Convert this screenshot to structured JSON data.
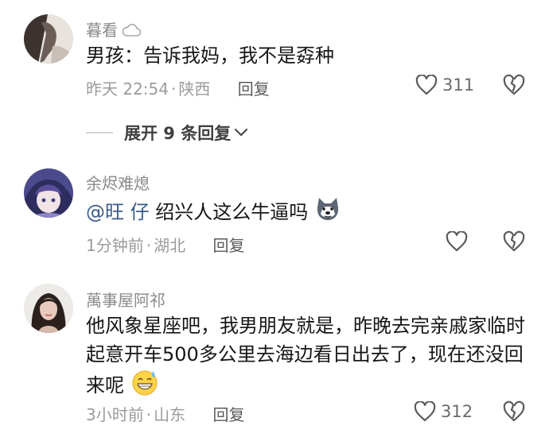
{
  "comments": [
    {
      "username": "暮看",
      "badge_icon": "cloud-icon",
      "text": "男孩：告诉我妈，我不是孬种",
      "time": "昨天 22:54",
      "location": "陕西",
      "reply_label": "回复",
      "likes": "311"
    },
    {
      "username": "余烬难熄",
      "mention": "@旺 仔",
      "text": " 绍兴人这么牛逼吗",
      "emoji_icon": "husky-dog-emoji",
      "time": "1分钟前",
      "location": "湖北",
      "reply_label": "回复",
      "likes": ""
    },
    {
      "username": "萬事屋阿祁",
      "text": "他风象星座吧，我男朋友就是，昨晚去完亲戚家临时起意开车500多公里去海边看日出去了，现在还没回来呢",
      "emoji_icon": "grinning-sweat-emoji",
      "time": "3小时前",
      "location": "山东",
      "reply_label": "回复",
      "likes": "312"
    }
  ],
  "expand_replies": "展开 9 条回复",
  "separator": "·",
  "colors": {
    "text": "#161616",
    "meta": "#9b9b9b",
    "mention": "#3a5a8c"
  }
}
